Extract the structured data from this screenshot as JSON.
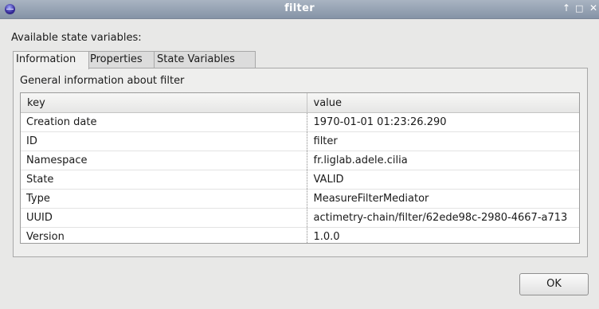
{
  "window": {
    "title": "filter",
    "controls": {
      "maximize": "↑",
      "restore": "□",
      "close": "✕"
    },
    "app_icon": "eclipse-icon"
  },
  "section_label": "Available state variables:",
  "tabs": [
    {
      "label": "Information",
      "active": true
    },
    {
      "label": "Properties",
      "active": false
    },
    {
      "label": "State Variables",
      "active": false
    }
  ],
  "panel": {
    "title": "General information about filter"
  },
  "table": {
    "headers": [
      "key",
      "value"
    ],
    "rows": [
      {
        "key": "Creation date",
        "value": "1970-01-01 01:23:26.290"
      },
      {
        "key": "ID",
        "value": "filter"
      },
      {
        "key": "Namespace",
        "value": "fr.liglab.adele.cilia"
      },
      {
        "key": "State",
        "value": "VALID"
      },
      {
        "key": "Type",
        "value": "MeasureFilterMediator"
      },
      {
        "key": "UUID",
        "value": "actimetry-chain/filter/62ede98c-2980-4667-a713"
      },
      {
        "key": "Version",
        "value": "1.0.0"
      }
    ]
  },
  "buttons": {
    "ok": "OK"
  }
}
